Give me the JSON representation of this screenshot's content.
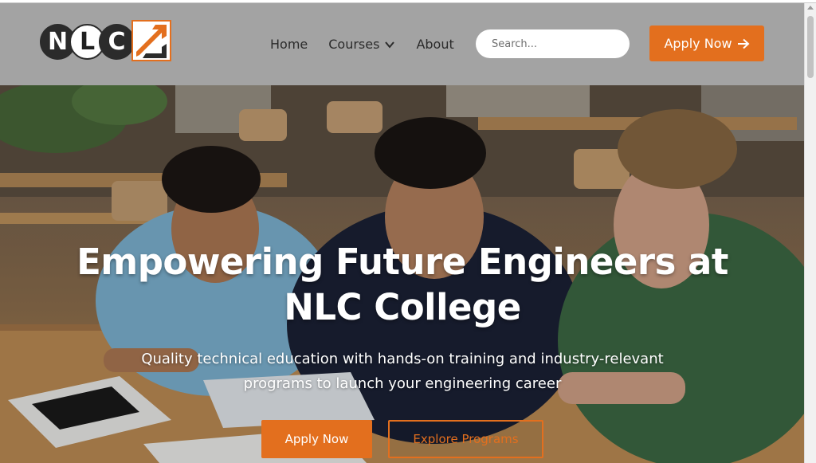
{
  "header": {
    "logo": {
      "letters": [
        "N",
        "L",
        "C"
      ],
      "mark_icon": "arrow-up-right-icon"
    },
    "nav": [
      {
        "label": "Home"
      },
      {
        "label": "Courses",
        "icon": "chevron-down-icon"
      },
      {
        "label": "About"
      }
    ],
    "search": {
      "placeholder": "Search...",
      "value": "",
      "icon": "search-icon"
    },
    "apply_button": {
      "label": "Apply Now",
      "icon": "arrow-right-icon"
    }
  },
  "hero": {
    "title_line1": "Empowering Future Engineers at",
    "title_line2": "NLC College",
    "subtitle_line1": "Quality technical education with hands-on training and industry-relevant",
    "subtitle_line2": "programs to launch your engineering career",
    "primary_button": "Apply Now",
    "secondary_button": "Explore Programs"
  },
  "colors": {
    "accent": "#e36f1e",
    "header_bg": "#a3a3a3",
    "text_dark": "#2b2b2b",
    "white": "#ffffff"
  }
}
